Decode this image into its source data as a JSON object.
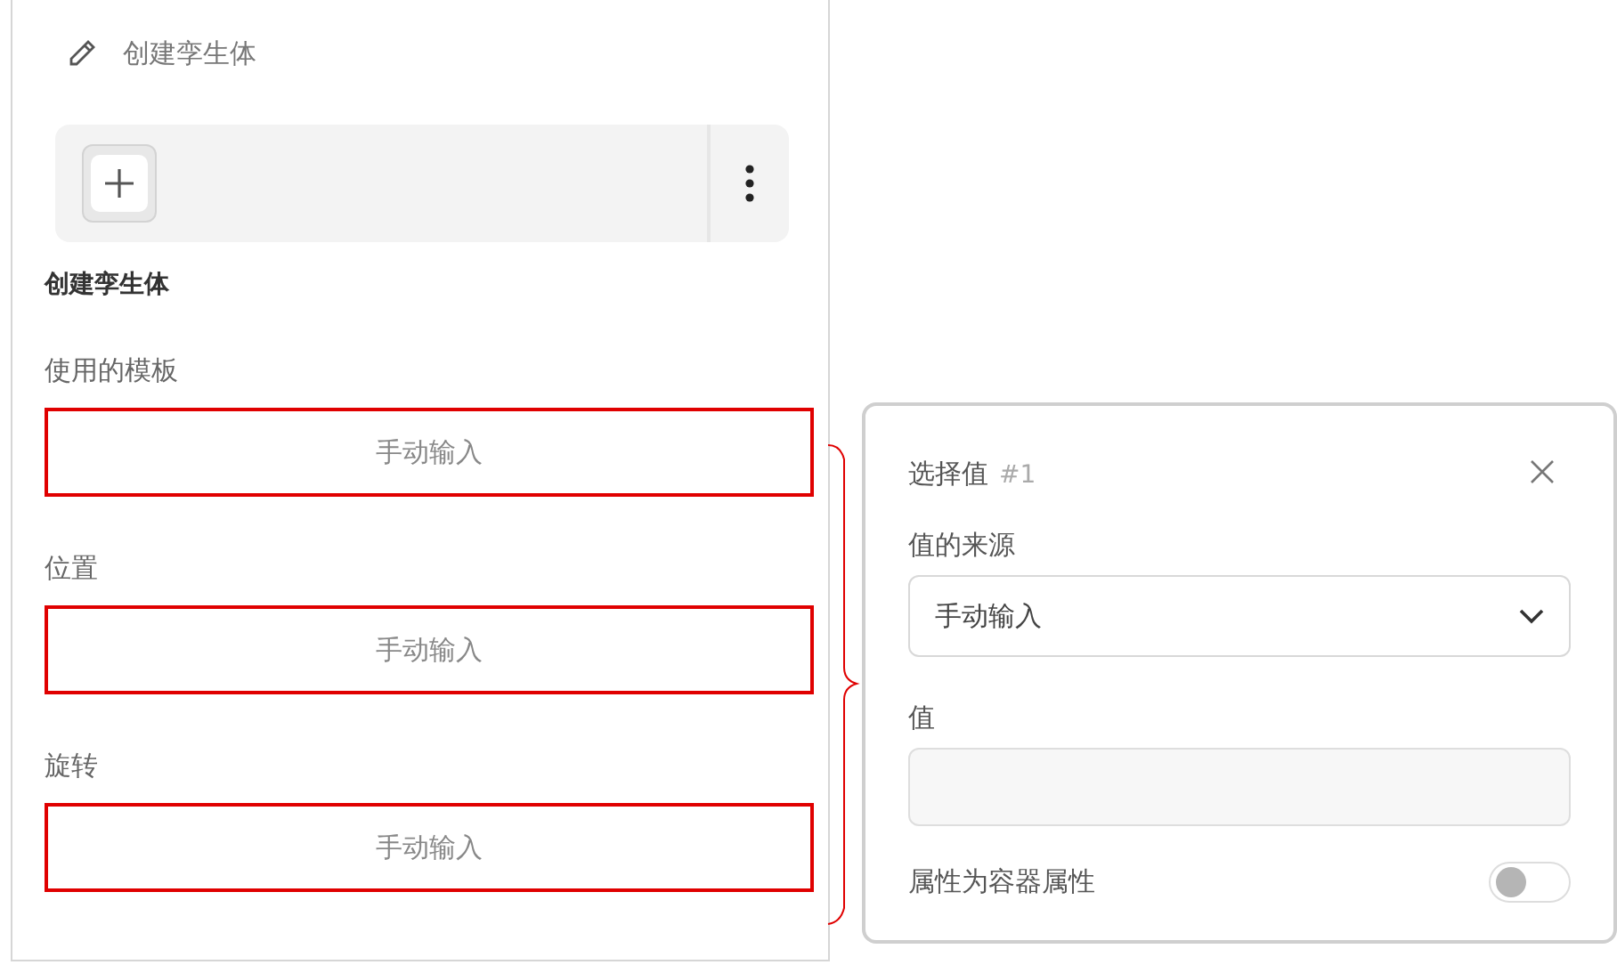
{
  "panel": {
    "title": "创建孪生体",
    "section_title": "创建孪生体",
    "fields": [
      {
        "label": "使用的模板",
        "value": "手动输入",
        "highlighted": true
      },
      {
        "label": "位置",
        "value": "手动输入",
        "highlighted": true
      },
      {
        "label": "旋转",
        "value": "手动输入",
        "highlighted": true
      }
    ]
  },
  "popover": {
    "title": "选择值",
    "number": "#1",
    "source_label": "值的来源",
    "source_value": "手动输入",
    "value_label": "值",
    "toggle_label": "属性为容器属性",
    "toggle_on": false
  }
}
